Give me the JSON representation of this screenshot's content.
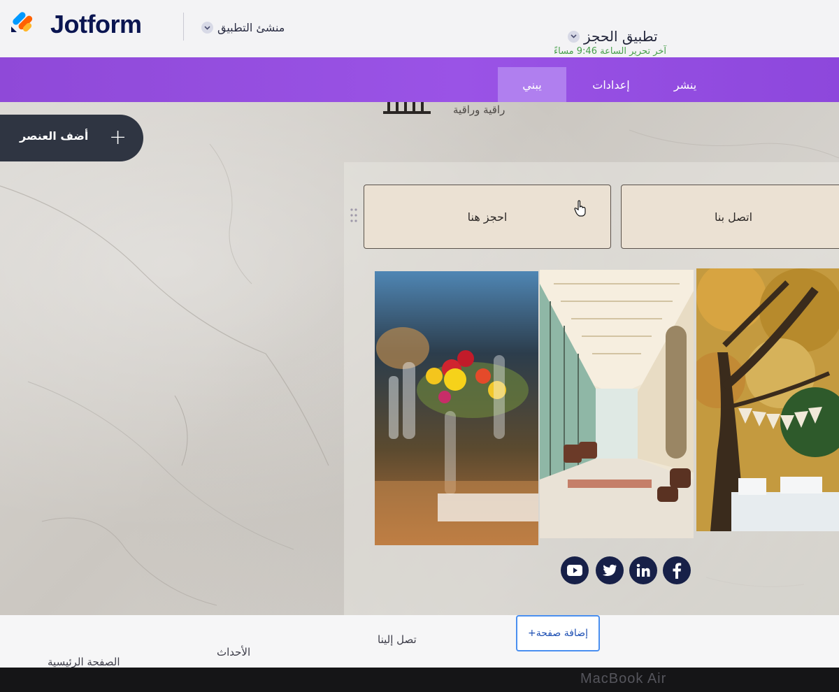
{
  "header": {
    "brand": "Jotform",
    "builder_menu": "منشئ التطبيق",
    "app_title": "تطبيق الحجز",
    "last_edited": "آخر تحرير الساعة 9:46 مساءً"
  },
  "nav": {
    "tabs": [
      {
        "label": "يبني",
        "active": true
      },
      {
        "label": "إعدادات",
        "active": false
      },
      {
        "label": "ينشر",
        "active": false
      }
    ],
    "accent": "#9a53e6",
    "active_tab_color": "#b07fef"
  },
  "canvas": {
    "tagline": "راقية وراقية",
    "add_element_label": "أضف العنصر",
    "buttons": {
      "book": "احجز هنا",
      "contact": "اتصل بنا"
    },
    "images": [
      "table-flowers-photo",
      "hall-corridor-photo",
      "garden-tree-photo"
    ],
    "social": [
      "youtube-icon",
      "twitter-icon",
      "linkedin-icon",
      "facebook-icon"
    ]
  },
  "page_bar": {
    "pages": [
      {
        "label": "الصفحة الرئيسية"
      },
      {
        "label": "الأحداث"
      },
      {
        "label": "تصل إلينا"
      }
    ],
    "add_page_label": "إضافة صفحة+"
  },
  "device_label": "MacBook Air"
}
